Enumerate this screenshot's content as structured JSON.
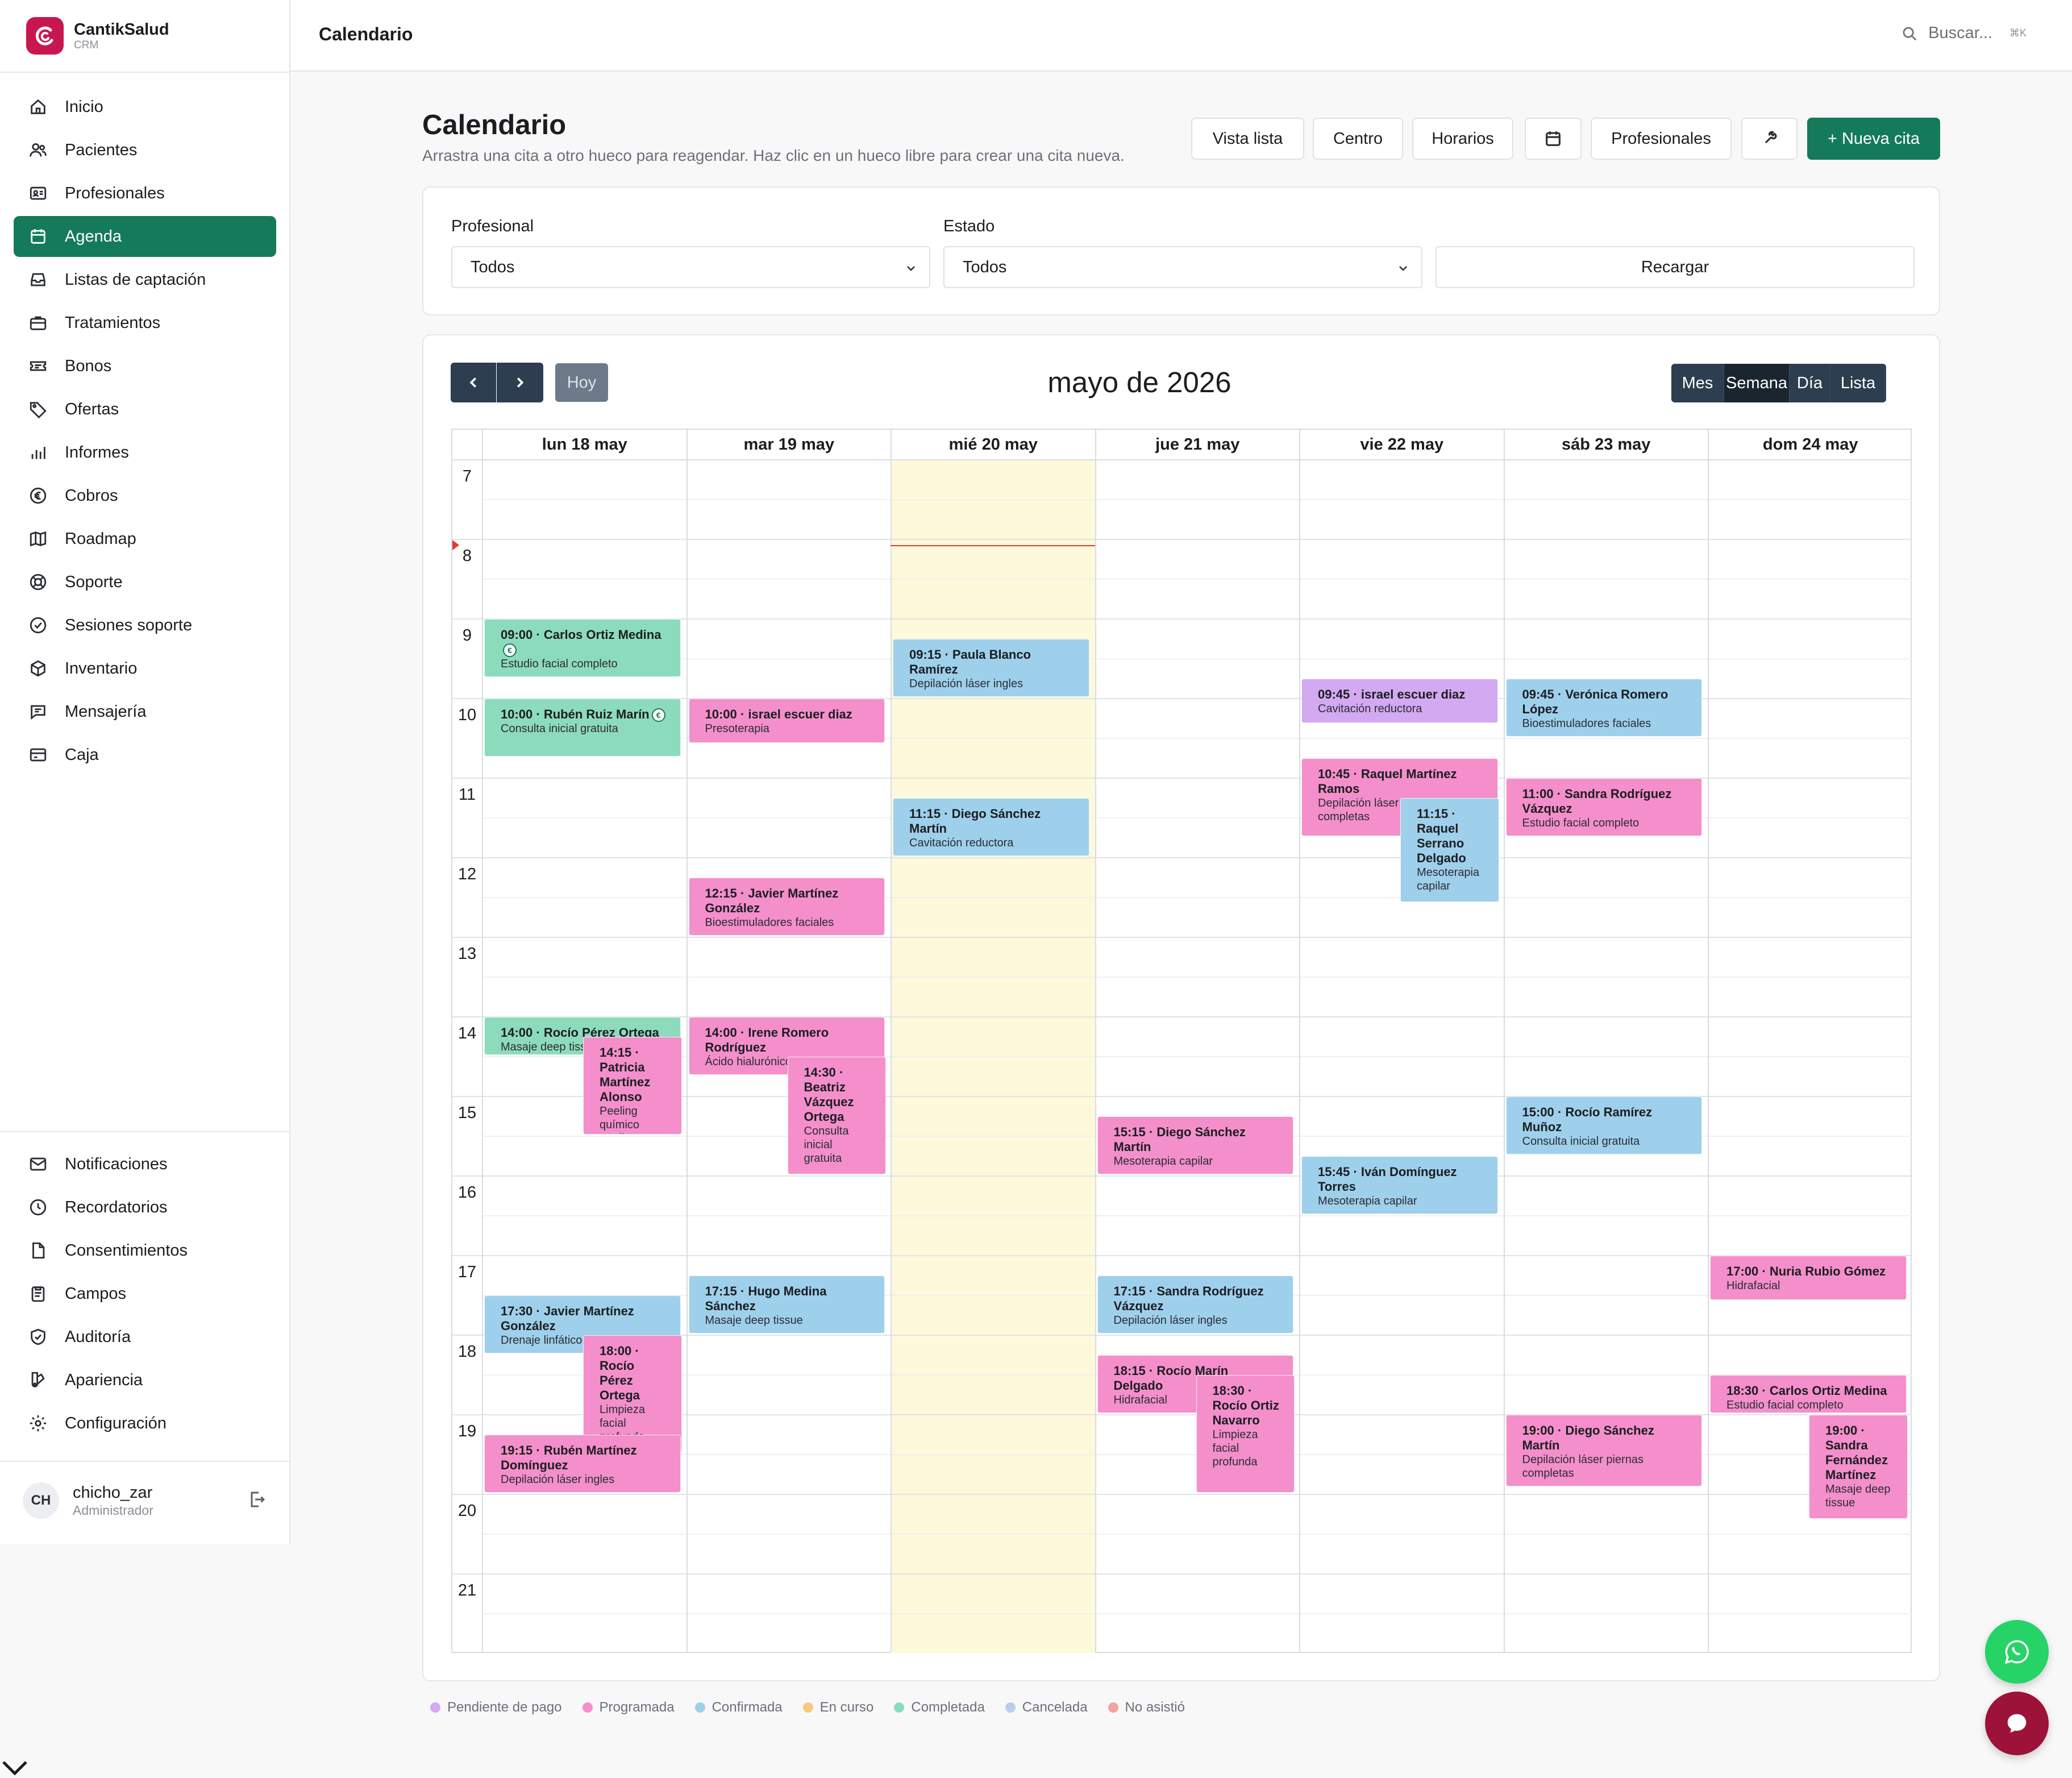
{
  "brand": {
    "name": "CantikSalud",
    "sub": "CRM"
  },
  "topbar": {
    "title": "Calendario",
    "search_placeholder": "Buscar...",
    "shortcut": "⌘K"
  },
  "sidebar": {
    "main_items": [
      {
        "label": "Inicio",
        "icon": "home-icon"
      },
      {
        "label": "Pacientes",
        "icon": "users-icon"
      },
      {
        "label": "Profesionales",
        "icon": "id-card-icon"
      },
      {
        "label": "Agenda",
        "icon": "calendar-icon",
        "active": true
      },
      {
        "label": "Listas de captación",
        "icon": "inbox-icon"
      },
      {
        "label": "Tratamientos",
        "icon": "briefcase-icon"
      },
      {
        "label": "Bonos",
        "icon": "ticket-icon"
      },
      {
        "label": "Ofertas",
        "icon": "tag-icon"
      },
      {
        "label": "Informes",
        "icon": "bar-chart-icon"
      },
      {
        "label": "Cobros",
        "icon": "euro-icon"
      },
      {
        "label": "Roadmap",
        "icon": "map-icon"
      },
      {
        "label": "Soporte",
        "icon": "lifebuoy-icon"
      },
      {
        "label": "Sesiones soporte",
        "icon": "check-circle-icon"
      },
      {
        "label": "Inventario",
        "icon": "box-icon"
      },
      {
        "label": "Mensajería",
        "icon": "chat-icon"
      },
      {
        "label": "Caja",
        "icon": "credit-card-icon"
      }
    ],
    "bottom_items": [
      {
        "label": "Notificaciones",
        "icon": "mail-icon"
      },
      {
        "label": "Recordatorios",
        "icon": "clock-icon"
      },
      {
        "label": "Consentimientos",
        "icon": "file-icon"
      },
      {
        "label": "Campos",
        "icon": "clipboard-icon"
      },
      {
        "label": "Auditoría",
        "icon": "shield-check-icon"
      },
      {
        "label": "Apariencia",
        "icon": "palette-icon"
      },
      {
        "label": "Configuración",
        "icon": "gear-icon"
      }
    ],
    "user": {
      "initials": "CH",
      "name": "chicho_zar",
      "role": "Administrador"
    }
  },
  "page": {
    "title": "Calendario",
    "subtitle": "Arrastra una cita a otro hueco para reagendar. Haz clic en un hueco libre para crear una cita nueva.",
    "buttons": {
      "list_view": "Vista lista",
      "center": "Centro",
      "schedules": "Horarios",
      "professionals": "Profesionales",
      "new_appointment": "+ Nueva cita"
    }
  },
  "filters": {
    "professional_label": "Profesional",
    "professional_value": "Todos",
    "status_label": "Estado",
    "status_value": "Todos",
    "reload": "Recargar"
  },
  "calendar": {
    "title": "mayo de 2026",
    "today": "Hoy",
    "views": [
      "Mes",
      "Semana",
      "Día",
      "Lista"
    ],
    "active_view": "Semana",
    "days": [
      "lun 18 may",
      "mar 19 may",
      "mié 20 may",
      "jue 21 may",
      "vie 22 may",
      "sáb 23 may",
      "dom 24 may"
    ],
    "today_index": 2,
    "hours": [
      "7",
      "8",
      "9",
      "10",
      "11",
      "12",
      "13",
      "14",
      "15",
      "16",
      "17",
      "18",
      "19",
      "20",
      "21"
    ],
    "now_time": 8.08,
    "events": [
      {
        "day": 0,
        "start": 9.0,
        "end": 9.75,
        "time": "09:00",
        "name": "Carlos Ortiz Medina",
        "service": "Estudio facial completo",
        "color": "green",
        "paid_icon": true
      },
      {
        "day": 0,
        "start": 10.0,
        "end": 10.75,
        "time": "10:00",
        "name": "Rubén Ruiz Marín",
        "service": "Consulta inicial gratuita",
        "color": "green",
        "paid_icon": true
      },
      {
        "day": 0,
        "start": 14.0,
        "end": 14.5,
        "time": "14:00",
        "name": "Rocío Pérez Ortega",
        "service": "Masaje deep tissue",
        "color": "green"
      },
      {
        "day": 0,
        "start": 14.25,
        "end": 15.5,
        "time": "14:15",
        "name": "Patricia Martínez Alonso",
        "service": "Peeling químico medio",
        "color": "pink",
        "lane": 1
      },
      {
        "day": 0,
        "start": 17.5,
        "end": 18.25,
        "time": "17:30",
        "name": "Javier Martínez González",
        "service": "Drenaje linfático",
        "color": "blue"
      },
      {
        "day": 0,
        "start": 18.0,
        "end": 19.5,
        "time": "18:00",
        "name": "Rocío Pérez Ortega",
        "service": "Limpieza facial profunda",
        "color": "pink",
        "lane": 1
      },
      {
        "day": 0,
        "start": 19.25,
        "end": 20.0,
        "time": "19:15",
        "name": "Rubén Martínez Domínguez",
        "service": "Depilación láser ingles",
        "color": "pink"
      },
      {
        "day": 1,
        "start": 10.0,
        "end": 10.58,
        "time": "10:00",
        "name": "israel escuer diaz",
        "service": "Presoterapia",
        "color": "pink"
      },
      {
        "day": 1,
        "start": 12.25,
        "end": 13.0,
        "time": "12:15",
        "name": "Javier Martínez González",
        "service": "Bioestimuladores faciales",
        "color": "pink"
      },
      {
        "day": 1,
        "start": 14.0,
        "end": 14.75,
        "time": "14:00",
        "name": "Irene Romero Rodríguez",
        "service": "Ácido hialurónico",
        "color": "pink"
      },
      {
        "day": 1,
        "start": 14.5,
        "end": 16.0,
        "time": "14:30",
        "name": "Beatriz Vázquez Ortega",
        "service": "Consulta inicial gratuita",
        "color": "pink",
        "lane": 1
      },
      {
        "day": 1,
        "start": 17.25,
        "end": 18.0,
        "time": "17:15",
        "name": "Hugo Medina Sánchez",
        "service": "Masaje deep tissue",
        "color": "blue"
      },
      {
        "day": 2,
        "start": 9.25,
        "end": 10.0,
        "time": "09:15",
        "name": "Paula Blanco Ramírez",
        "service": "Depilación láser ingles",
        "color": "blue"
      },
      {
        "day": 2,
        "start": 11.25,
        "end": 12.0,
        "time": "11:15",
        "name": "Diego Sánchez Martín",
        "service": "Cavitación reductora",
        "color": "blue"
      },
      {
        "day": 3,
        "start": 15.25,
        "end": 16.0,
        "time": "15:15",
        "name": "Diego Sánchez Martín",
        "service": "Mesoterapia capilar",
        "color": "pink"
      },
      {
        "day": 3,
        "start": 17.25,
        "end": 18.0,
        "time": "17:15",
        "name": "Sandra Rodríguez Vázquez",
        "service": "Depilación láser ingles",
        "color": "blue"
      },
      {
        "day": 3,
        "start": 18.25,
        "end": 19.0,
        "time": "18:15",
        "name": "Rocío Marín Delgado",
        "service": "Hidrafacial",
        "color": "pink"
      },
      {
        "day": 3,
        "start": 18.5,
        "end": 20.0,
        "time": "18:30",
        "name": "Rocío Ortiz Navarro",
        "service": "Limpieza facial profunda",
        "color": "pink",
        "lane": 1
      },
      {
        "day": 4,
        "start": 9.75,
        "end": 10.33,
        "time": "09:45",
        "name": "israel escuer diaz",
        "service": "Cavitación reductora",
        "color": "purple"
      },
      {
        "day": 4,
        "start": 10.75,
        "end": 11.75,
        "time": "10:45",
        "name": "Raquel Martínez Ramos",
        "service": "Depilación láser piernas completas",
        "color": "pink"
      },
      {
        "day": 4,
        "start": 11.25,
        "end": 12.58,
        "time": "11:15",
        "name": "Raquel Serrano Delgado",
        "service": "Mesoterapia capilar",
        "color": "blue",
        "lane": 1
      },
      {
        "day": 4,
        "start": 15.75,
        "end": 16.5,
        "time": "15:45",
        "name": "Iván Domínguez Torres",
        "service": "Mesoterapia capilar",
        "color": "blue"
      },
      {
        "day": 5,
        "start": 9.75,
        "end": 10.5,
        "time": "09:45",
        "name": "Verónica Romero López",
        "service": "Bioestimuladores faciales",
        "color": "blue"
      },
      {
        "day": 5,
        "start": 11.0,
        "end": 11.75,
        "time": "11:00",
        "name": "Sandra Rodríguez Vázquez",
        "service": "Estudio facial completo",
        "color": "pink"
      },
      {
        "day": 5,
        "start": 15.0,
        "end": 15.75,
        "time": "15:00",
        "name": "Rocío Ramírez Muñoz",
        "service": "Consulta inicial gratuita",
        "color": "blue"
      },
      {
        "day": 5,
        "start": 19.0,
        "end": 19.92,
        "time": "19:00",
        "name": "Diego Sánchez Martín",
        "service": "Depilación láser piernas completas",
        "color": "pink"
      },
      {
        "day": 6,
        "start": 17.0,
        "end": 17.58,
        "time": "17:00",
        "name": "Nuria Rubio Gómez",
        "service": "Hidrafacial",
        "color": "pink"
      },
      {
        "day": 6,
        "start": 18.5,
        "end": 19.0,
        "time": "18:30",
        "name": "Carlos Ortiz Medina",
        "service": "Estudio facial completo",
        "color": "pink"
      },
      {
        "day": 6,
        "start": 19.0,
        "end": 20.33,
        "time": "19:00",
        "name": "Sandra Fernández Martínez",
        "service": "Masaje deep tissue",
        "color": "pink",
        "lane": 1
      }
    ]
  },
  "legend": [
    {
      "label": "Pendiente de pago",
      "color": "#d3a9f1"
    },
    {
      "label": "Programada",
      "color": "#f48fcb"
    },
    {
      "label": "Confirmada",
      "color": "#9ed0eb"
    },
    {
      "label": "En curso",
      "color": "#f7c97e"
    },
    {
      "label": "Completada",
      "color": "#8ddbbd"
    },
    {
      "label": "Cancelada",
      "color": "#b9cdee"
    },
    {
      "label": "No asistió",
      "color": "#f3a3a3"
    }
  ],
  "colors": {
    "accent": "#147a5a",
    "brand": "#c8174e",
    "calendar_nav": "#2c3e50",
    "today_bg": "#fdf9da",
    "now_line": "#e53935"
  }
}
